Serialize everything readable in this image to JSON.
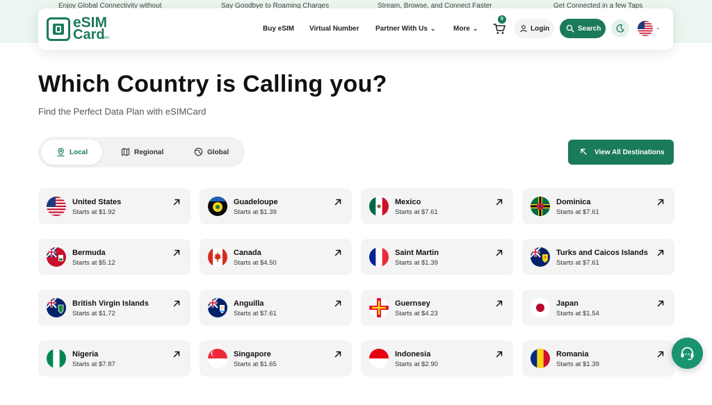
{
  "ticker": [
    "Enjoy Global Connectivity without",
    "Say Goodbye to Roaming Charges",
    "Stream, Browse, and Connect Faster",
    "Get Connected in a few Taps"
  ],
  "logo": {
    "line1": "eSIM",
    "line2": "Card",
    "suffix": ".com"
  },
  "nav": {
    "buy_esim": "Buy eSIM",
    "virtual_number": "Virtual Number",
    "partner": "Partner With Us",
    "more": "More",
    "cart_count": "0",
    "login": "Login",
    "search": "Search"
  },
  "hero": {
    "title": "Which Country is Calling you?",
    "subtitle": "Find the Perfect Data Plan with eSIMCard"
  },
  "tabs": [
    "Local",
    "Regional",
    "Global"
  ],
  "view_all": "View All Destinations",
  "colors": {
    "brand": "#1a7a5c",
    "card_bg": "#f4f4f4"
  },
  "countries": [
    {
      "name": "United States",
      "price": "Starts at $1.92",
      "flag": "us"
    },
    {
      "name": "Guadeloupe",
      "price": "Starts at $1.39",
      "flag": "guadeloupe"
    },
    {
      "name": "Mexico",
      "price": "Starts at $7.61",
      "flag": "mexico"
    },
    {
      "name": "Dominica",
      "price": "Starts at $7.61",
      "flag": "dominica"
    },
    {
      "name": "Bermuda",
      "price": "Starts at $5.12",
      "flag": "bermuda"
    },
    {
      "name": "Canada",
      "price": "Starts at $4.50",
      "flag": "canada"
    },
    {
      "name": "Saint Martin",
      "price": "Starts at $1.39",
      "flag": "saint-martin"
    },
    {
      "name": "Turks and Caicos Islands",
      "price": "Starts at $7.61",
      "flag": "turks-caicos"
    },
    {
      "name": "British Virgin Islands",
      "price": "Starts at $1.72",
      "flag": "bvi"
    },
    {
      "name": "Anguilla",
      "price": "Starts at $7.61",
      "flag": "anguilla"
    },
    {
      "name": "Guernsey",
      "price": "Starts at $4.23",
      "flag": "guernsey"
    },
    {
      "name": "Japan",
      "price": "Starts at $1.54",
      "flag": "japan"
    },
    {
      "name": "Nigeria",
      "price": "Starts at $7.87",
      "flag": "nigeria"
    },
    {
      "name": "Singapore",
      "price": "Starts at $1.65",
      "flag": "singapore"
    },
    {
      "name": "Indonesia",
      "price": "Starts at $2.90",
      "flag": "indonesia"
    },
    {
      "name": "Romania",
      "price": "Starts at $1.39",
      "flag": "romania"
    }
  ]
}
